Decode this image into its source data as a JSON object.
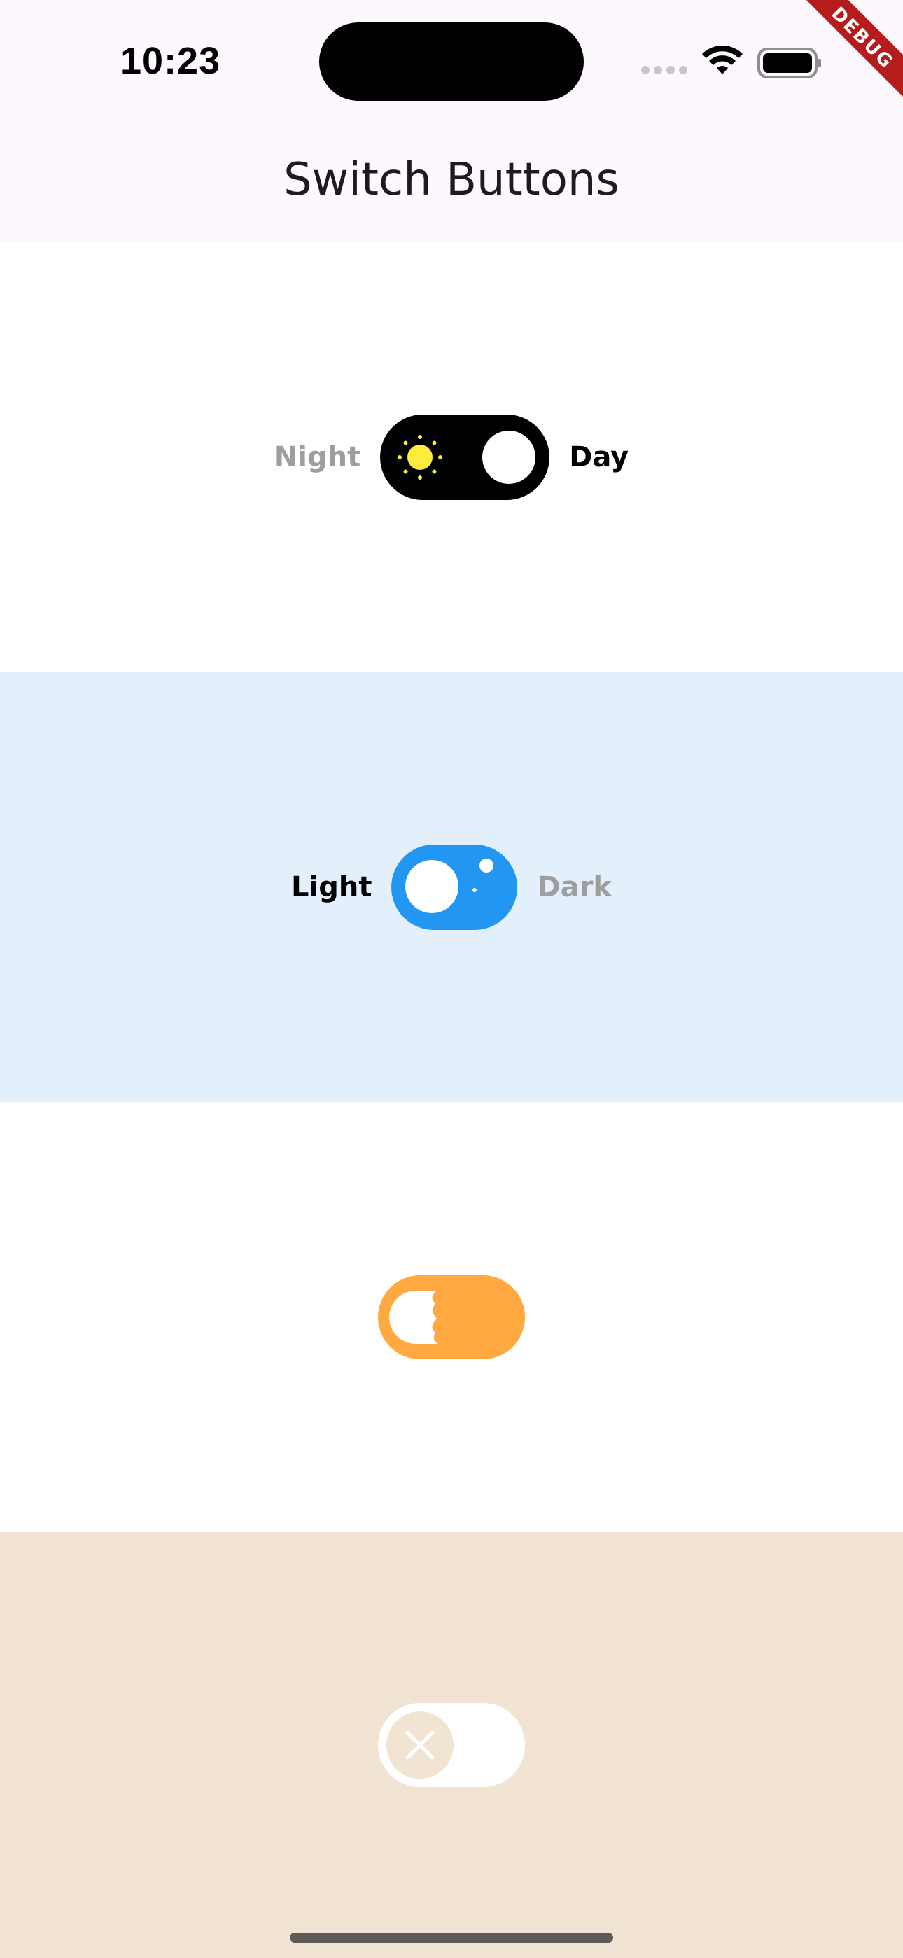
{
  "status_bar": {
    "time": "10:23",
    "icons": [
      "cellular-dots-icon",
      "wifi-icon",
      "battery-icon"
    ]
  },
  "app_bar": {
    "title": "Switch Buttons"
  },
  "debug_banner": {
    "text": "DEBUG",
    "color": "#b71c1c"
  },
  "switches": [
    {
      "left_label": "Night",
      "right_label": "Day",
      "track_color": "#000000",
      "icon": "sun-icon",
      "state": "on",
      "section_bg": "#ffffff"
    },
    {
      "left_label": "Light",
      "right_label": "Dark",
      "track_color": "#2196f3",
      "icon": "stars-icon",
      "state": "off",
      "section_bg": "#e3f0fb"
    },
    {
      "track_color": "#ffa940",
      "icon": "moon-knob-icon",
      "state": "off",
      "section_bg": "#ffffff"
    },
    {
      "track_color": "#ffffff",
      "icon": "close-icon",
      "state": "off",
      "section_bg": "#f1e4d3"
    }
  ]
}
